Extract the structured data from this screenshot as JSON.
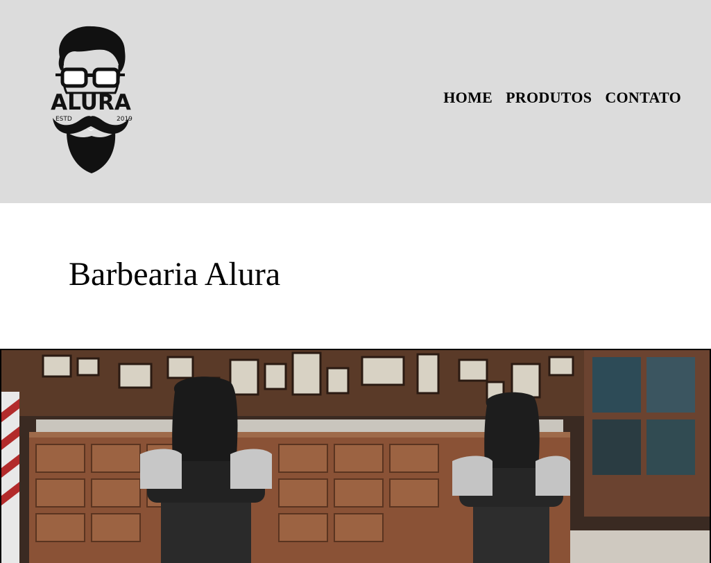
{
  "header": {
    "logo": {
      "text": "ALURA",
      "left_text": "ESTD",
      "right_text": "2019"
    },
    "nav": [
      {
        "label": "HOME"
      },
      {
        "label": "PRODUTOS"
      },
      {
        "label": "CONTATO"
      }
    ]
  },
  "main": {
    "title": "Barbearia Alura"
  },
  "hero": {
    "image_description": "Barbershop interior with leather barber chairs and wooden cabinets"
  },
  "colors": {
    "header_bg": "#dcdcdc",
    "text": "#000000",
    "wood": "#7a4a30"
  }
}
